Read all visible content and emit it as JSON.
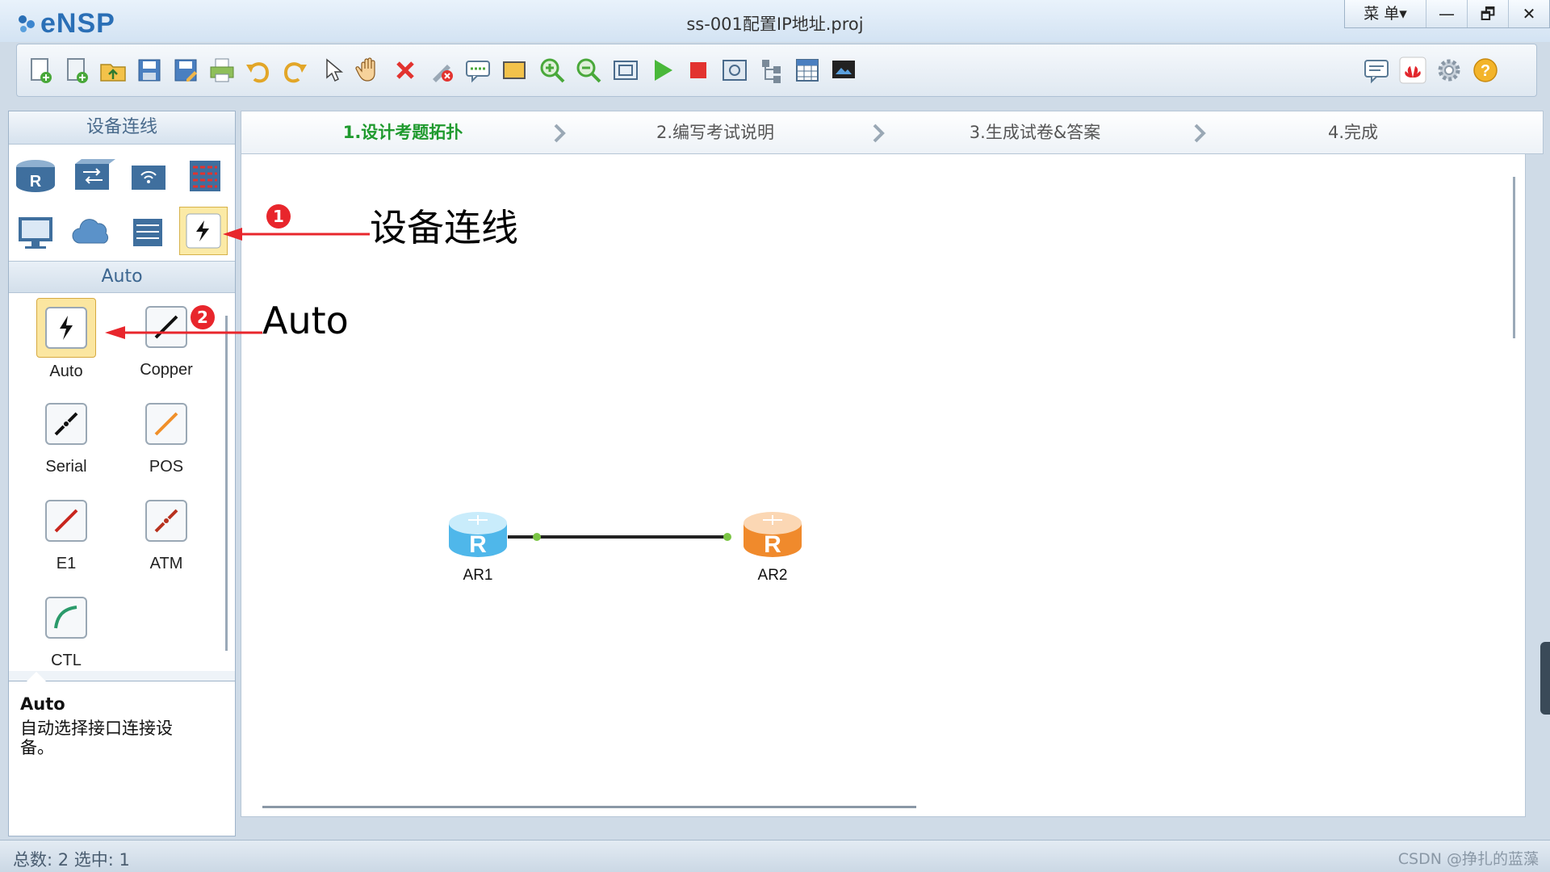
{
  "app": {
    "logo_text": "eNSP",
    "window_title": "ss-001配置IP地址.proj",
    "menu_label": "菜 单▾",
    "minimize_glyph": "—",
    "restore_glyph": "🗗",
    "close_glyph": "✕"
  },
  "toolbar": {
    "icons": [
      "new-topology-icon",
      "new-exam-icon",
      "open-icon",
      "save-icon",
      "save-as-icon",
      "print-icon",
      "undo-icon",
      "redo-icon",
      "select-pointer-icon",
      "pan-hand-icon",
      "delete-icon",
      "delete-link-icon",
      "text-annotation-icon",
      "rectangle-icon",
      "zoom-in-icon",
      "zoom-out-icon",
      "fit-view-icon",
      "start-device-icon",
      "stop-device-icon",
      "capture-icon",
      "topology-tree-icon",
      "grid-icon",
      "screen-icon",
      "chat-icon",
      "huawei-icon",
      "settings-icon",
      "help-icon"
    ]
  },
  "left_panel": {
    "header": "设备连线",
    "devices": [
      "router-icon",
      "switch-icon",
      "wireless-icon",
      "firewall-icon",
      "pc-icon",
      "cloud-icon",
      "other-device-icon",
      "connection-icon"
    ],
    "subheader": "Auto",
    "cables": [
      {
        "label": "Auto",
        "color": "#111111",
        "icon": "auto-lightning-icon"
      },
      {
        "label": "Copper",
        "color": "#111111",
        "icon": "copper-cable-icon"
      },
      {
        "label": "Serial",
        "color": "#111111",
        "icon": "serial-cable-icon"
      },
      {
        "label": "POS",
        "color": "#f0902a",
        "icon": "pos-cable-icon"
      },
      {
        "label": "E1",
        "color": "#c8261e",
        "icon": "e1-cable-icon"
      },
      {
        "label": "ATM",
        "color": "#b8321f",
        "icon": "atm-cable-icon"
      },
      {
        "label": "CTL",
        "color": "#2a9a6a",
        "icon": "ctl-cable-icon"
      }
    ],
    "info_title": "Auto",
    "info_desc": "自动选择接口连接设备。"
  },
  "steps": [
    "1.设计考题拓扑",
    "2.编写考试说明",
    "3.生成试卷&答案",
    "4.完成"
  ],
  "topology": {
    "nodes": [
      {
        "label": "AR1",
        "color": "#4fb7ea"
      },
      {
        "label": "AR2",
        "color": "#f08a2c"
      }
    ],
    "link_endpoint_color": "#7bc545"
  },
  "annotations": [
    {
      "badge": "1",
      "text": "设备连线"
    },
    {
      "badge": "2",
      "text": "Auto"
    }
  ],
  "statusbar": {
    "text": "总数: 2 选中: 1",
    "watermark": "CSDN @挣扎的蓝藻"
  }
}
